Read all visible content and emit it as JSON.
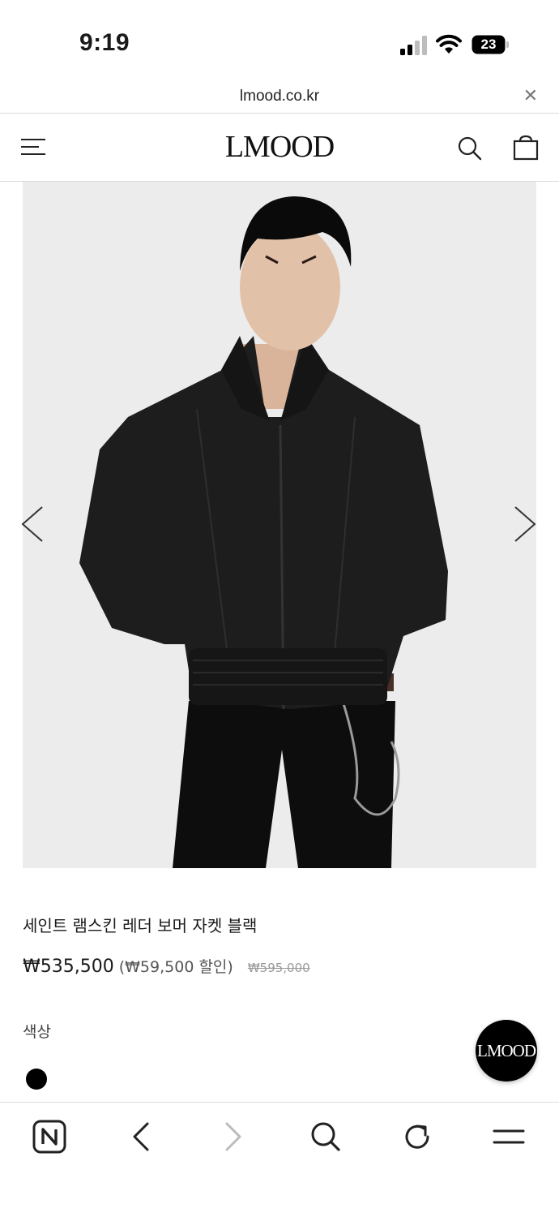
{
  "status_bar": {
    "time": "9:19",
    "battery_level": "23"
  },
  "browser": {
    "url": "lmood.co.kr",
    "close_icon": "close-icon"
  },
  "header": {
    "logo": "LMOOD",
    "menu_icon": "hamburger-menu-icon",
    "search_icon": "search-icon",
    "cart_icon": "shopping-bag-icon"
  },
  "gallery": {
    "prev_icon": "chevron-left-icon",
    "next_icon": "chevron-right-icon"
  },
  "product": {
    "name": "세인트 램스킨 레더 보머 자켓 블랙",
    "price": "₩535,500",
    "discount": "(₩59,500 할인)",
    "original_price": "₩595,000",
    "color_label": "색상",
    "color_swatch": "#000000"
  },
  "floating_button": {
    "label": "LMOOD"
  },
  "bottom_bar": {
    "icons": [
      "naver-n-icon",
      "back-icon",
      "forward-icon",
      "search-icon",
      "refresh-icon",
      "menu-icon"
    ]
  }
}
